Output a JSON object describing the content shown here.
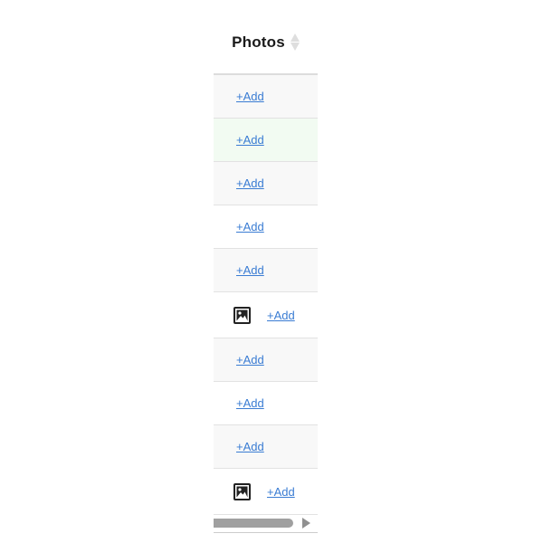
{
  "column": {
    "title": "Photos"
  },
  "rows": [
    {
      "add_label": "+Add",
      "has_photo": false
    },
    {
      "add_label": "+Add",
      "has_photo": false
    },
    {
      "add_label": "+Add",
      "has_photo": false
    },
    {
      "add_label": "+Add",
      "has_photo": false
    },
    {
      "add_label": "+Add",
      "has_photo": false
    },
    {
      "add_label": "+Add",
      "has_photo": true
    },
    {
      "add_label": "+Add",
      "has_photo": false
    },
    {
      "add_label": "+Add",
      "has_photo": false
    },
    {
      "add_label": "+Add",
      "has_photo": false
    },
    {
      "add_label": "+Add",
      "has_photo": true
    }
  ],
  "icons": {
    "sort": "sort-icon",
    "photo": "image-icon"
  },
  "colors": {
    "link": "#3a7cd3",
    "highlight_row": "#f2fbf2",
    "striped_row": "#f8f8f8"
  }
}
